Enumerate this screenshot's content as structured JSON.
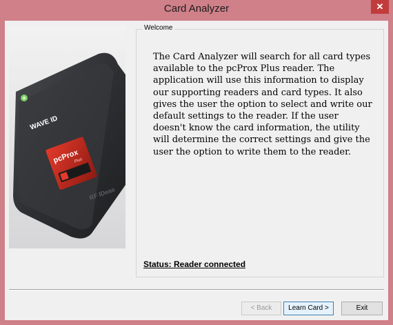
{
  "window": {
    "title": "Card Analyzer",
    "close_glyph": "✕"
  },
  "image": {
    "brand_label": "WAVE ID",
    "product_label": "pcProx",
    "product_sub": "Plus",
    "maker_label": "RF IDeas"
  },
  "welcome": {
    "legend": "Welcome",
    "description": "The Card Analyzer will search for all card types available to the pcProx Plus reader. The application will use this information to display our supporting readers and card types. It also gives the user the option to select and write our default  settings to the reader. If the user doesn't know the card information, the utility will determine the correct settings and give the user the option to write them to the reader."
  },
  "status": {
    "text": "Status: Reader connected"
  },
  "buttons": {
    "back": "< Back",
    "learn": "Learn Card >",
    "exit": "Exit"
  }
}
